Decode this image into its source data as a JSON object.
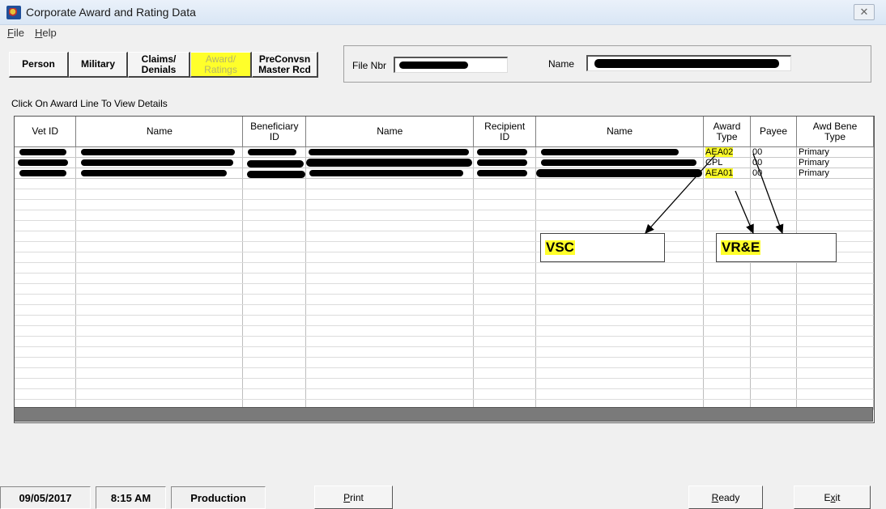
{
  "window": {
    "title": "Corporate Award and Rating Data",
    "close_glyph": "✕"
  },
  "menu": [
    {
      "key": "F",
      "rest": "ile"
    },
    {
      "key": "H",
      "rest": "elp"
    }
  ],
  "nav": {
    "person": "Person",
    "military": "Military",
    "claims": "Claims/\nDenials",
    "awards": "Award/\nRatings",
    "preconvsn": "PreConvsn\nMaster Rcd"
  },
  "fields": {
    "file_nbr_label": "File Nbr",
    "name_label": "Name"
  },
  "hint": "Click On Award Line To View Details",
  "table": {
    "headers": [
      "Vet ID",
      "Name",
      "Beneficiary\nID",
      "Name",
      "Recipient\nID",
      "Name",
      "Award\nType",
      "Payee",
      "Awd Bene\nType"
    ],
    "rows": [
      {
        "award_type": "AEA02",
        "payee": "00",
        "bene_type": "Primary"
      },
      {
        "award_type": "CPL",
        "payee": "00",
        "bene_type": "Primary"
      },
      {
        "award_type": "AEA01",
        "payee": "00",
        "bene_type": "Primary"
      }
    ]
  },
  "callouts": {
    "vsc": "VSC",
    "vre": "VR&E"
  },
  "status": {
    "date": "09/05/2017",
    "time": "8:15 AM",
    "env": "Production"
  },
  "buttons": {
    "print_key": "P",
    "print_rest": "rint",
    "ready_key": "R",
    "ready_rest": "eady",
    "exit_pre": "E",
    "exit_key": "x",
    "exit_rest": "it"
  },
  "colors": {
    "highlight": "#ffff2a",
    "redaction": "#000000"
  }
}
